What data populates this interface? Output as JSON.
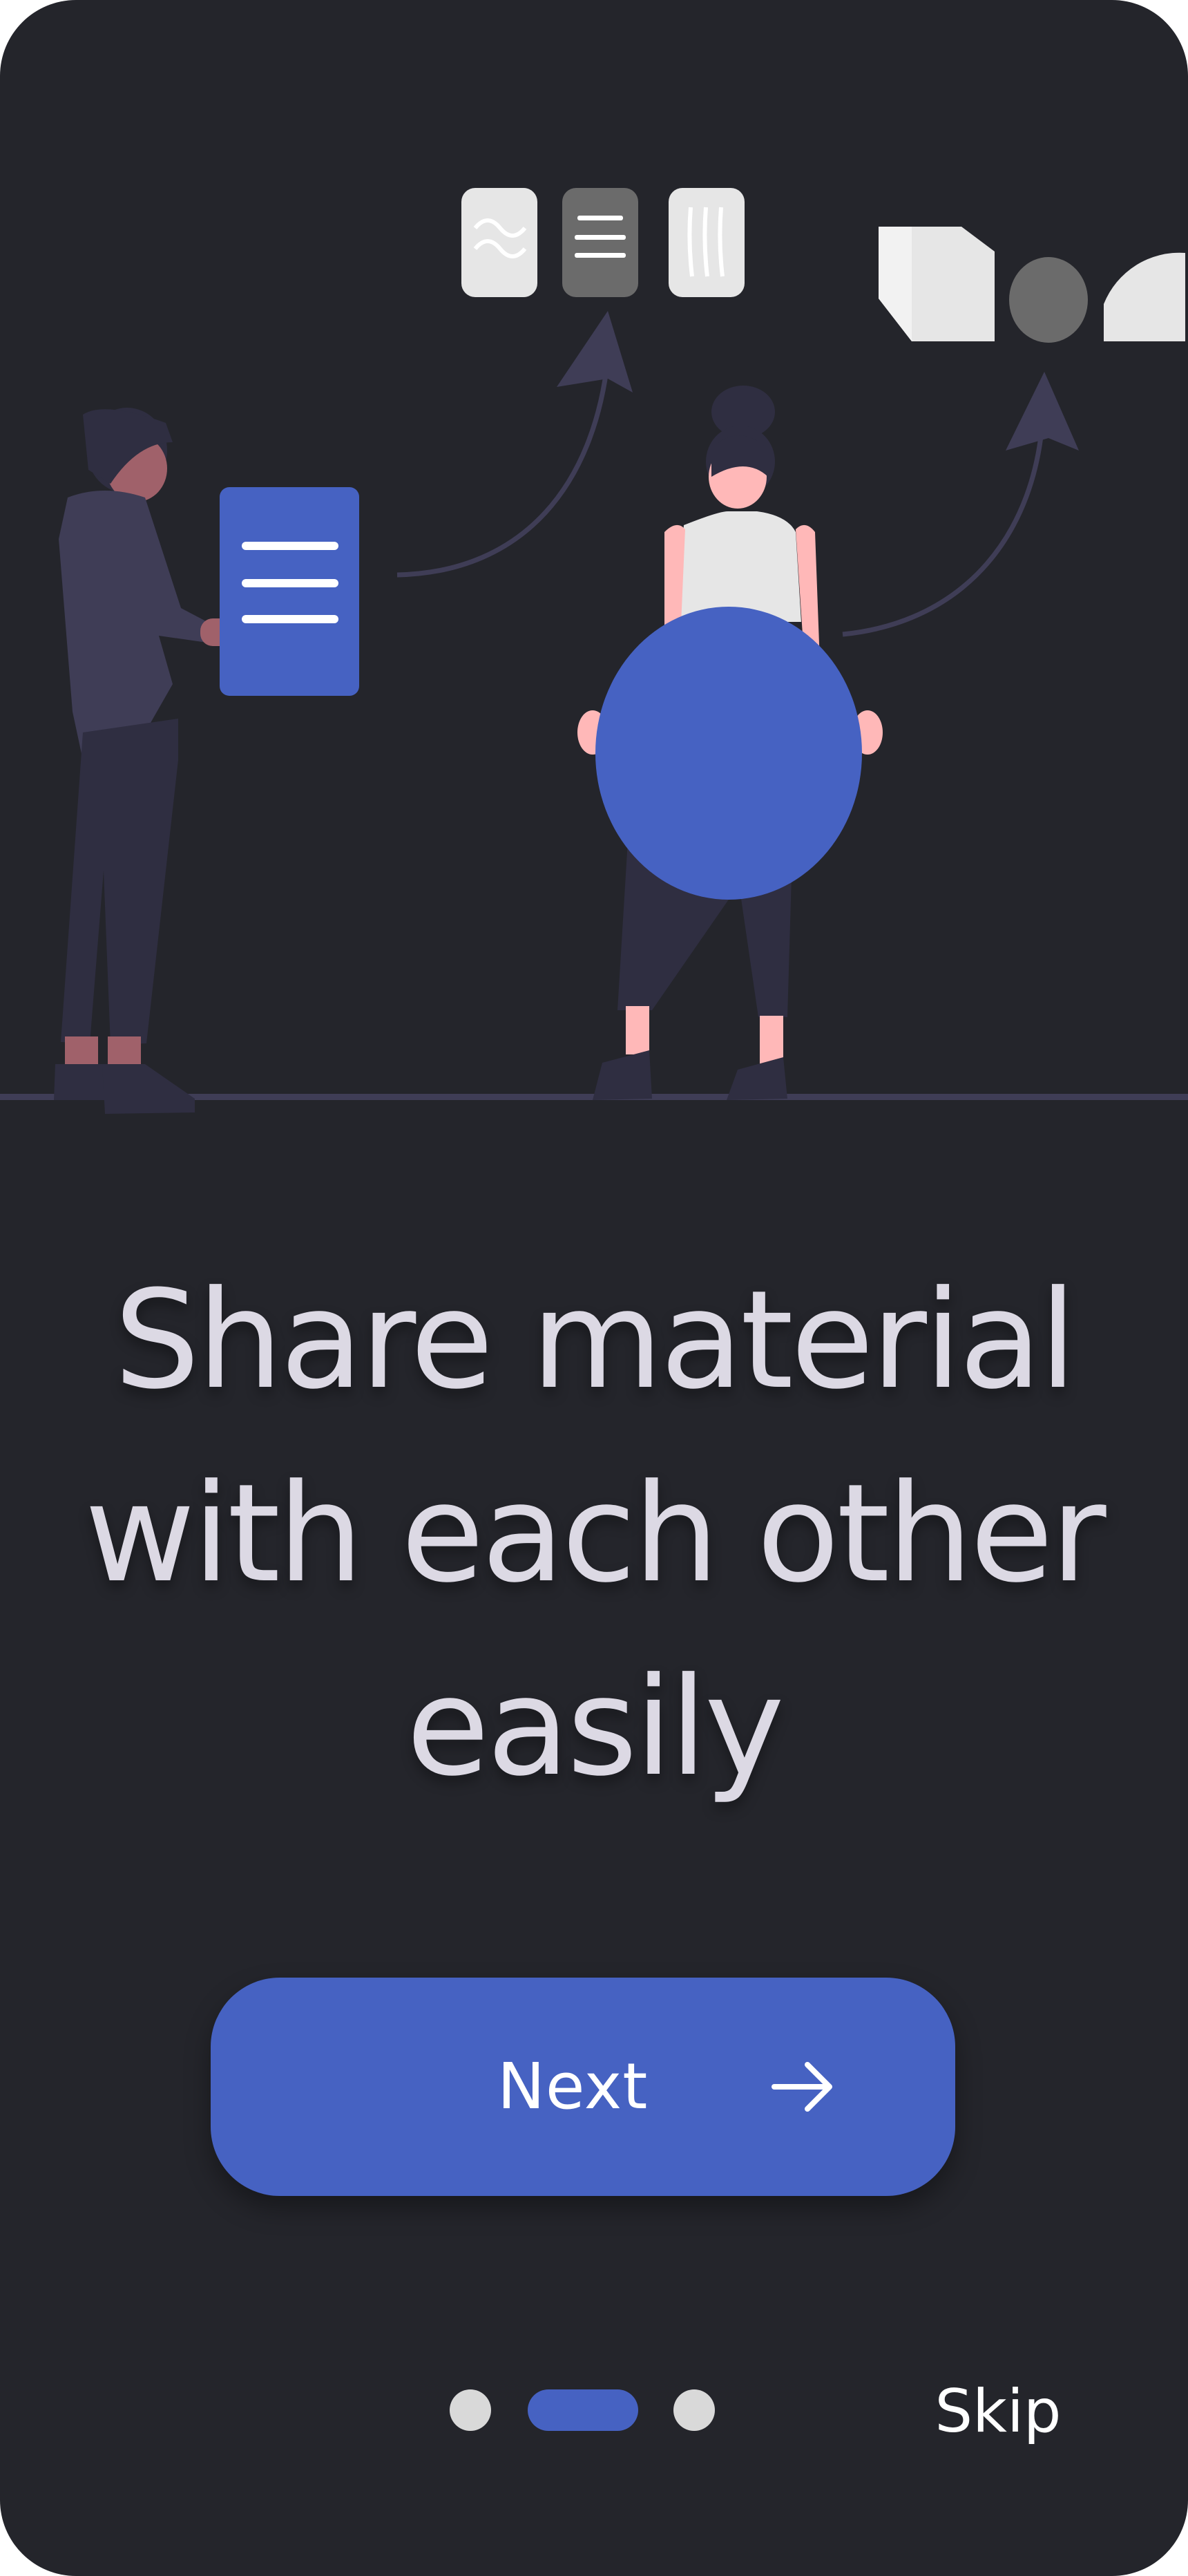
{
  "onboarding": {
    "headline": {
      "line1": "Share material",
      "line2": "with each other",
      "line3": "easily"
    },
    "next_button": {
      "label": "Next",
      "icon": "arrow-right-icon"
    },
    "skip_label": "Skip",
    "pagination": {
      "total_pages": 3,
      "active_page": 2
    }
  },
  "illustration": {
    "theme": "people-sharing-documents",
    "icons": [
      "document-icon",
      "cube-icon",
      "circle-icon",
      "half-circle-icon"
    ]
  },
  "colors": {
    "background": "#24252b",
    "accent": "#4662c2",
    "headline_text": "#dcd9e4",
    "button_text": "#ffffff",
    "inactive_dot": "#d9d9d9"
  }
}
